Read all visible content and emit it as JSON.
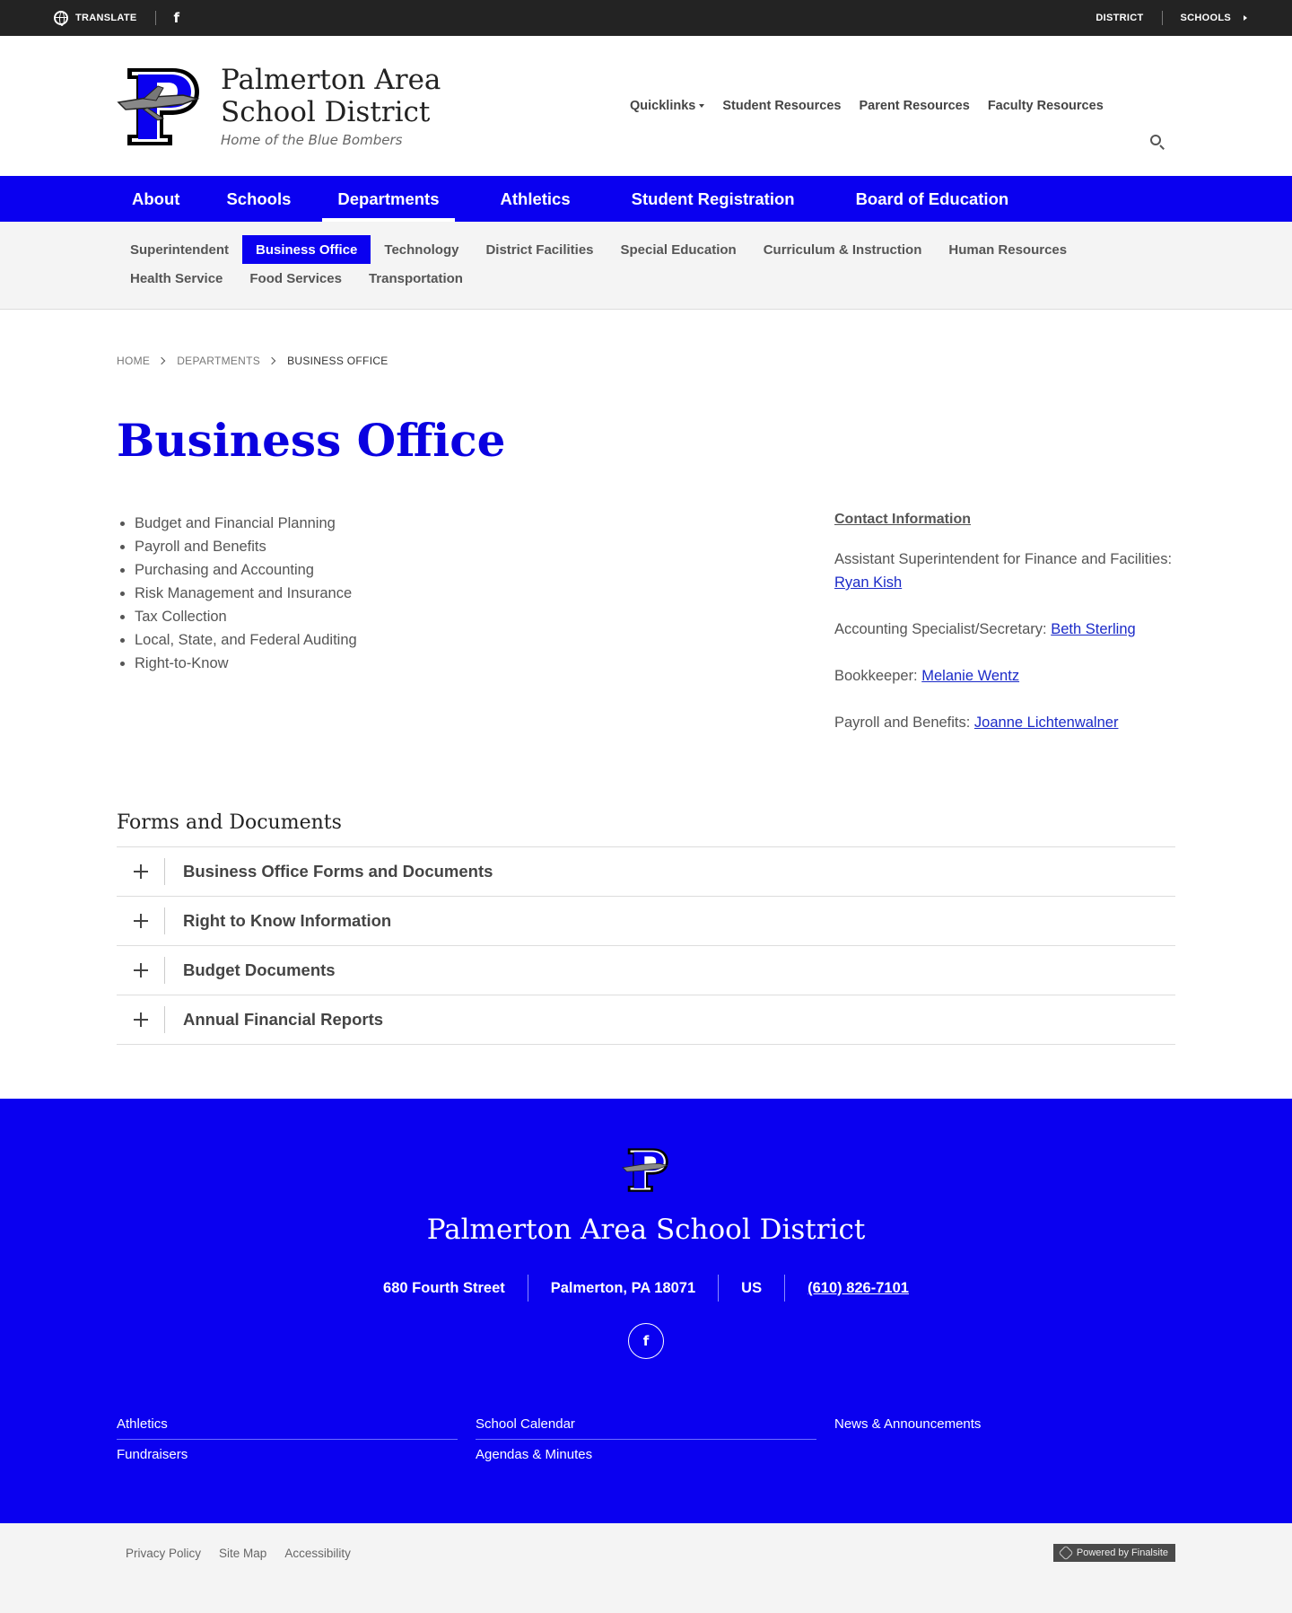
{
  "utility": {
    "translate": "TRANSLATE",
    "district": "DISTRICT",
    "schools": "SCHOOLS"
  },
  "brand": {
    "title": "Palmerton Area School District",
    "tagline": "Home of the Blue Bombers",
    "logo_letter": "P"
  },
  "header_nav": {
    "quicklinks": "Quicklinks",
    "student": "Student Resources",
    "parent": "Parent Resources",
    "faculty": "Faculty Resources"
  },
  "main_nav": [
    {
      "label": "About"
    },
    {
      "label": "Schools"
    },
    {
      "label": "Departments"
    },
    {
      "label": "Athletics"
    },
    {
      "label": "Student Registration"
    },
    {
      "label": "Board of Education"
    }
  ],
  "sub_nav": [
    {
      "label": "Superintendent"
    },
    {
      "label": "Business Office"
    },
    {
      "label": "Technology"
    },
    {
      "label": "District Facilities"
    },
    {
      "label": "Special Education"
    },
    {
      "label": "Curriculum & Instruction"
    },
    {
      "label": "Human Resources"
    },
    {
      "label": "Health Service"
    },
    {
      "label": "Food Services"
    },
    {
      "label": "Transportation"
    }
  ],
  "breadcrumb": [
    "HOME",
    "DEPARTMENTS",
    "BUSINESS OFFICE"
  ],
  "page_title": "Business Office",
  "services": [
    "Budget and Financial Planning",
    "Payroll and Benefits",
    "Purchasing and Accounting",
    "Risk Management and Insurance",
    "Tax Collection",
    "Local, State, and Federal Auditing",
    "Right-to-Know"
  ],
  "contact": {
    "heading": "Contact Information",
    "entries": [
      {
        "role": "Assistant Superintendent for Finance and Facilities: ",
        "name": "Ryan Kish"
      },
      {
        "role": "Accounting Specialist/Secretary: ",
        "name": "Beth Sterling"
      },
      {
        "role": "Bookkeeper: ",
        "name": "Melanie Wentz"
      },
      {
        "role": "Payroll and Benefits: ",
        "name": "Joanne Lichtenwalner"
      }
    ]
  },
  "forms": {
    "heading": "Forms and Documents",
    "items": [
      "Business Office Forms and Documents",
      "Right to Know Information",
      "Budget Documents",
      "Annual Financial Reports"
    ]
  },
  "footer": {
    "title": "Palmerton Area School District",
    "street": "680 Fourth Street",
    "city": "Palmerton, PA  18071",
    "country": "US",
    "phone": "(610) 826-7101",
    "links": {
      "col1": [
        "Athletics",
        "Fundraisers"
      ],
      "col2": [
        "School Calendar",
        "Agendas & Minutes"
      ],
      "col3": [
        "News & Announcements"
      ]
    }
  },
  "bottom": {
    "privacy": "Privacy Policy",
    "sitemap": "Site Map",
    "accessibility": "Accessibility",
    "powered": "Powered by Finalsite"
  },
  "colors": {
    "brand_blue": "#0a00f0",
    "topbar": "#232323",
    "link_blue": "#1b2ac8"
  }
}
